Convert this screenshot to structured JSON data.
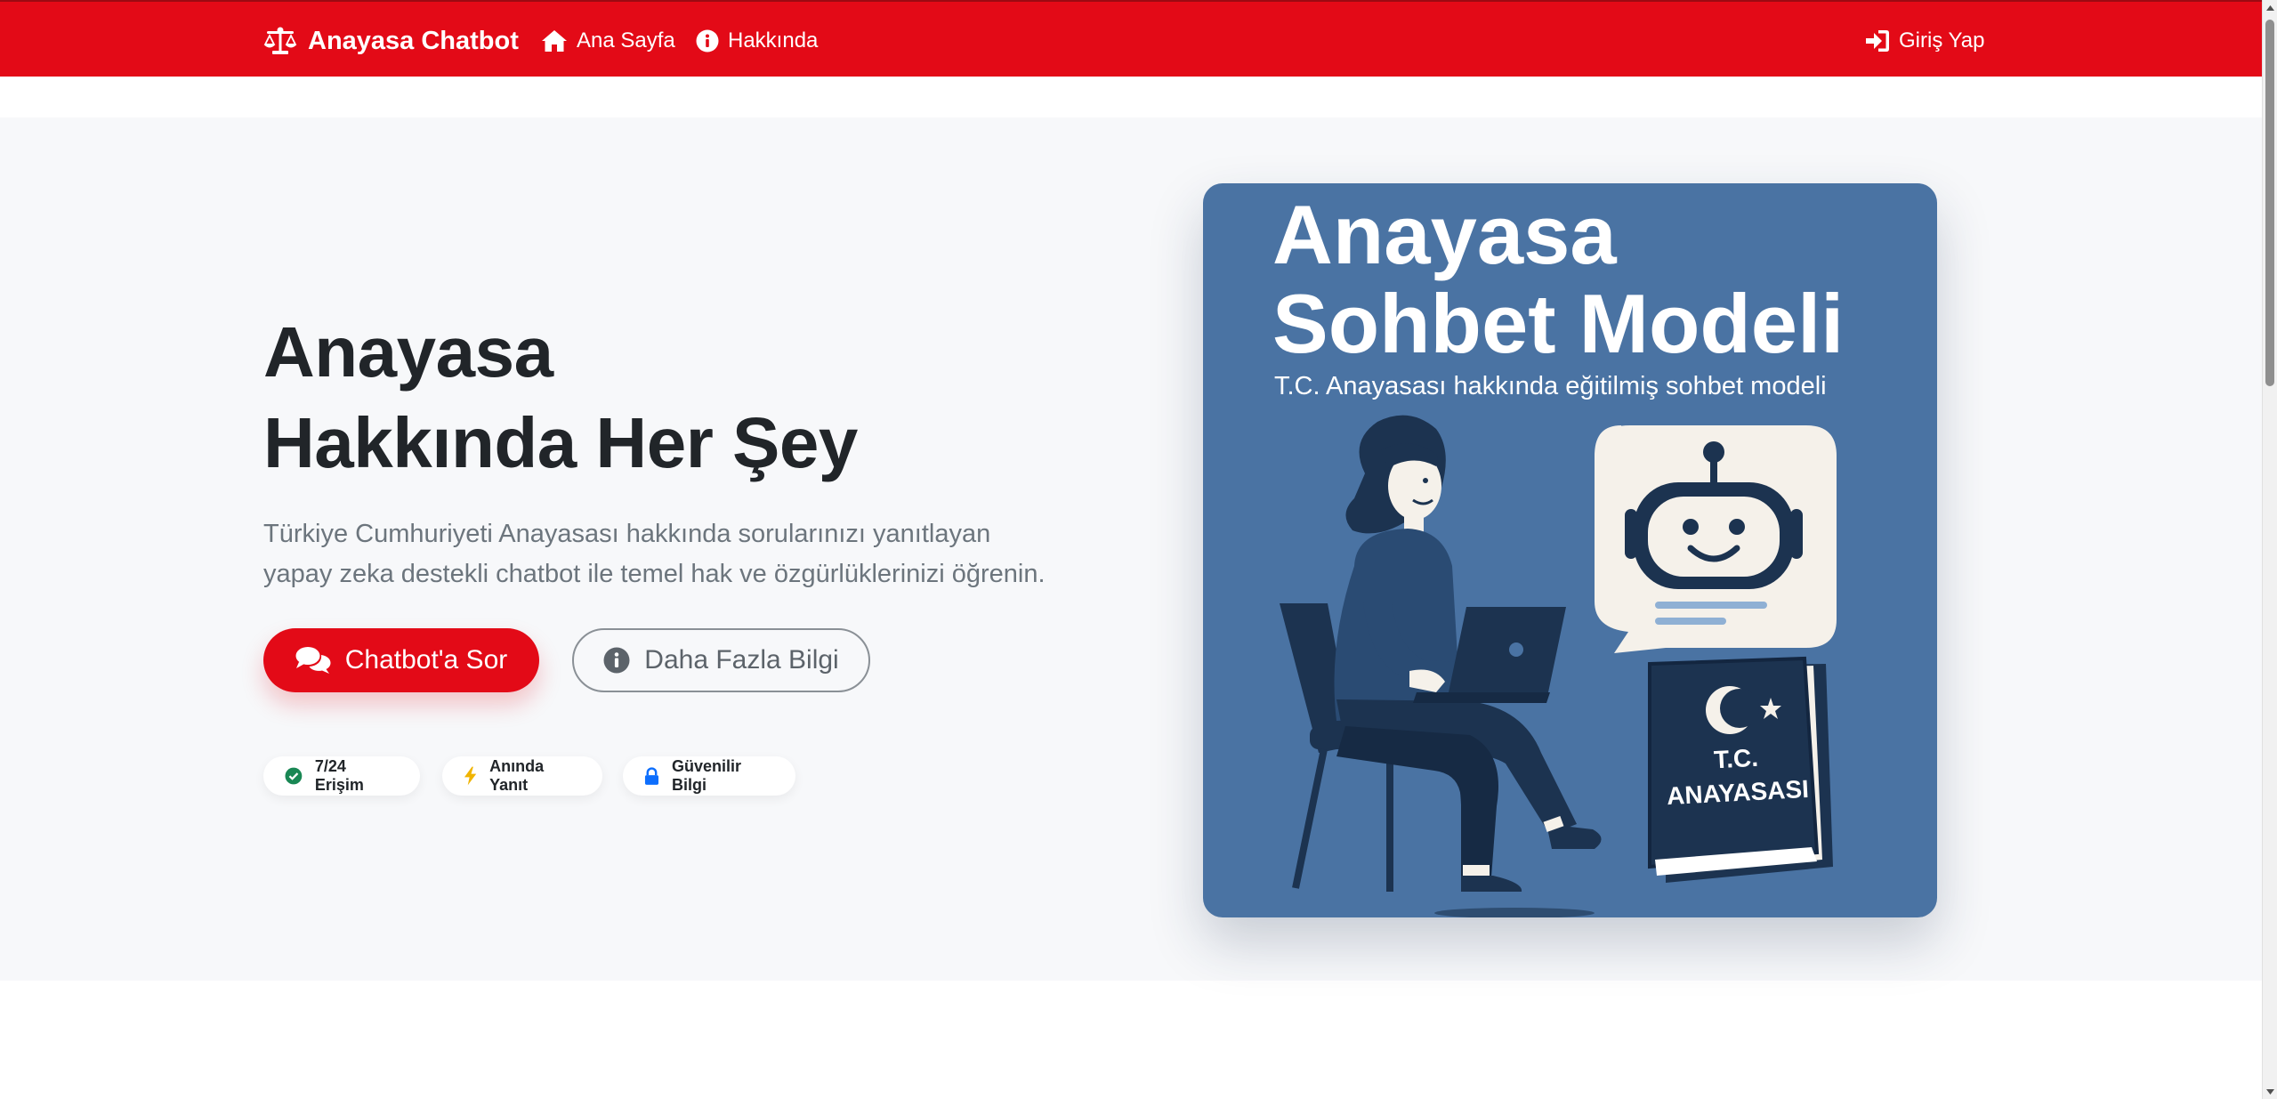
{
  "navbar": {
    "brand": "Anayasa Chatbot",
    "brand_icon": "scale-balance-icon",
    "links": [
      {
        "label": "Ana Sayfa",
        "icon": "home-icon"
      },
      {
        "label": "Hakkında",
        "icon": "info-circle-icon"
      }
    ],
    "login": {
      "label": "Giriş Yap",
      "icon": "sign-in-icon"
    },
    "color": "#e30a17"
  },
  "hero": {
    "title_lines": [
      "Anayasa",
      "Hakkında Her Şey"
    ],
    "lead_lines": [
      "Türkiye Cumhuriyeti Anayasası hakkında sorularınızı yanıtlayan",
      "yapay zeka destekli chatbot ile temel hak ve özgürlüklerinizi öğrenin."
    ],
    "primary_button": {
      "label": "Chatbot'a Sor",
      "icon": "comments-icon"
    },
    "secondary_button": {
      "label": "Daha Fazla Bilgi",
      "icon": "info-circle-icon"
    },
    "badges": [
      {
        "label": "7/24 Erişim",
        "icon": "check-circle-icon",
        "color": "#198754"
      },
      {
        "label": "Anında Yanıt",
        "icon": "bolt-icon",
        "color": "#f0b400"
      },
      {
        "label": "Güvenilir Bilgi",
        "icon": "lock-icon",
        "color": "#0d6efd"
      }
    ]
  },
  "illustration": {
    "title_lines": [
      "Anayasa",
      "Sohbet Modeli"
    ],
    "subtitle": "T.C. Anayasası hakkında eğitilmiş sohbet modeli",
    "book_lines": [
      "T.C.",
      "ANAYASASI"
    ],
    "background": "#4a73a3"
  }
}
